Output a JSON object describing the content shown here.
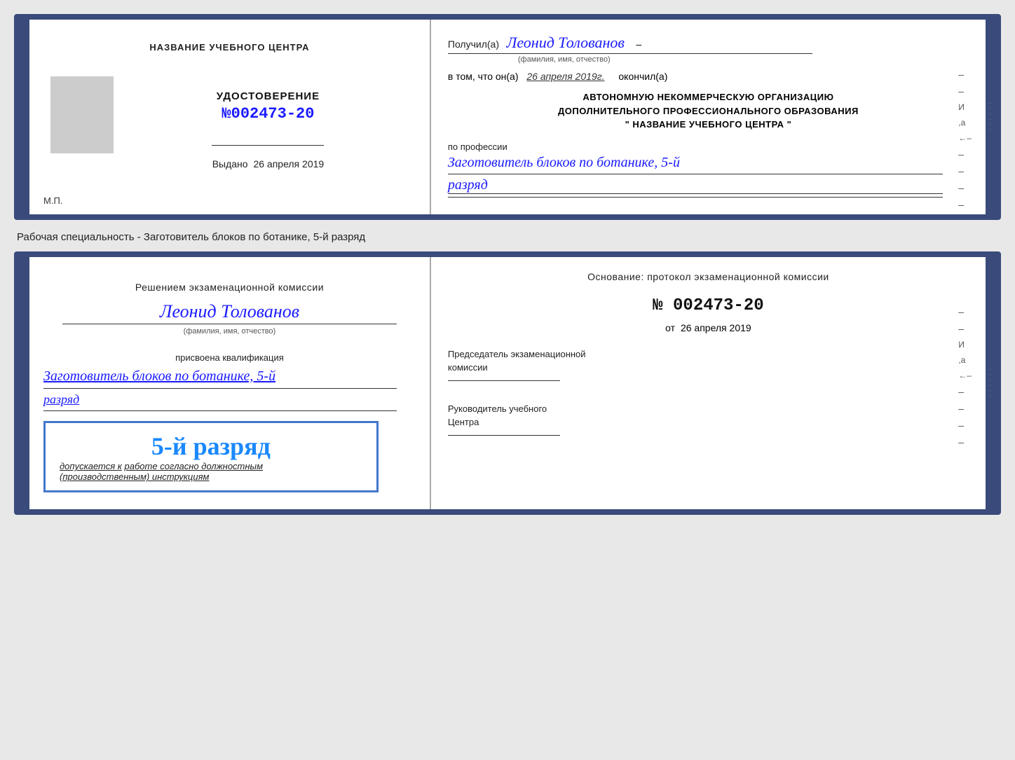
{
  "card1": {
    "left": {
      "heading": "НАЗВАНИЕ УЧЕБНОГО ЦЕНТРА",
      "cert_title": "УДОСТОВЕРЕНИЕ",
      "cert_number_prefix": "№",
      "cert_number": "002473-20",
      "issued_label": "Выдано",
      "issued_date": "26 апреля 2019",
      "mp_label": "М.П."
    },
    "right": {
      "received_prefix": "Получил(а)",
      "recipient_name": "Леонид Толованов",
      "fio_label": "(фамилия, имя, отчество)",
      "date_prefix": "в том, что он(а)",
      "date_value": "26 апреля 2019г.",
      "date_suffix": "окончил(а)",
      "org_line1": "АВТОНОМНУЮ НЕКОММЕРЧЕСКУЮ ОРГАНИЗАЦИЮ",
      "org_line2": "ДОПОЛНИТЕЛЬНОГО ПРОФЕССИОНАЛЬНОГО ОБРАЗОВАНИЯ",
      "org_line3": "\" НАЗВАНИЕ УЧЕБНОГО ЦЕНТРА \"",
      "profession_label": "по профессии",
      "profession_name": "Заготовитель блоков по ботанике, 5-й",
      "rank_name": "разряд"
    }
  },
  "specialty_label": "Рабочая специальность - Заготовитель блоков по ботанике, 5-й разряд",
  "card2": {
    "left": {
      "decision_line1": "Решением экзаменационной комиссии",
      "person_name": "Леонид Толованов",
      "fio_label": "(фамилия, имя, отчество)",
      "qualification_label": "присвоена квалификация",
      "qualification_name": "Заготовитель блоков по ботанике, 5-й",
      "rank_name": "разряд",
      "rank_display": "5-й разряд",
      "allowed_prefix": "допускается к",
      "allowed_text": "работе согласно должностным",
      "allowed_text2": "(производственным) инструкциям"
    },
    "right": {
      "basis_text": "Основание: протокол экзаменационной комиссии",
      "protocol_number": "№ 002473-20",
      "from_prefix": "от",
      "from_date": "26 апреля 2019",
      "chairman_line1": "Председатель экзаменационной",
      "chairman_line2": "комиссии",
      "director_line1": "Руководитель учебного",
      "director_line2": "Центра"
    }
  }
}
